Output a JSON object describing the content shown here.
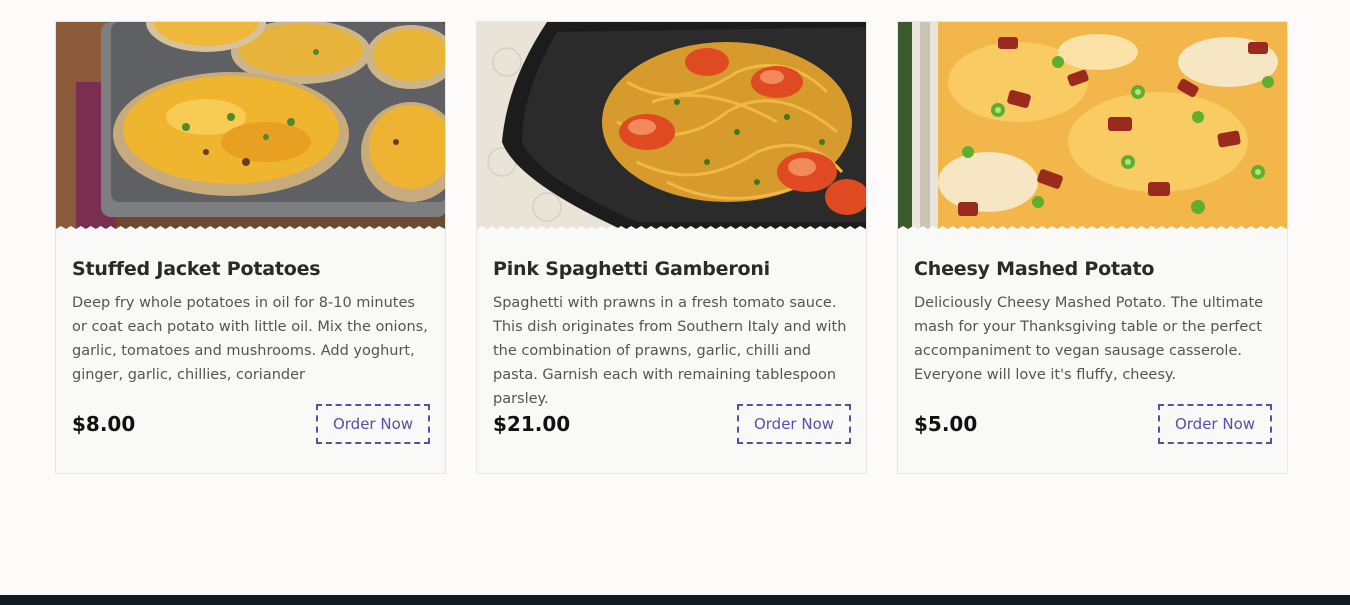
{
  "cards": [
    {
      "title": "Stuffed Jacket Potatoes",
      "description": "Deep fry whole potatoes in oil for 8-10 minutes or coat each potato with little oil. Mix the onions, garlic, tomatoes and mushrooms. Add yoghurt, ginger, garlic, chillies, coriander",
      "price": "$8.00",
      "button": "Order Now"
    },
    {
      "title": "Pink Spaghetti Gamberoni",
      "description": "Spaghetti with prawns in a fresh tomato sauce. This dish originates from Southern Italy and with the combination of prawns, garlic, chilli and pasta. Garnish each with remaining tablespoon parsley.",
      "price": "$21.00",
      "button": "Order Now"
    },
    {
      "title": "Cheesy Mashed Potato",
      "description": "Deliciously Cheesy Mashed Potato. The ultimate mash for your Thanksgiving table or the perfect accompaniment to vegan sausage casserole. Everyone will love it's fluffy, cheesy.",
      "price": "$5.00",
      "button": "Order Now"
    }
  ],
  "colors": {
    "page_background": "#fcfbf9",
    "card_background": "#f9f9f8",
    "button_accent": "#5a4fa6",
    "footer_bar": "#121a24"
  }
}
